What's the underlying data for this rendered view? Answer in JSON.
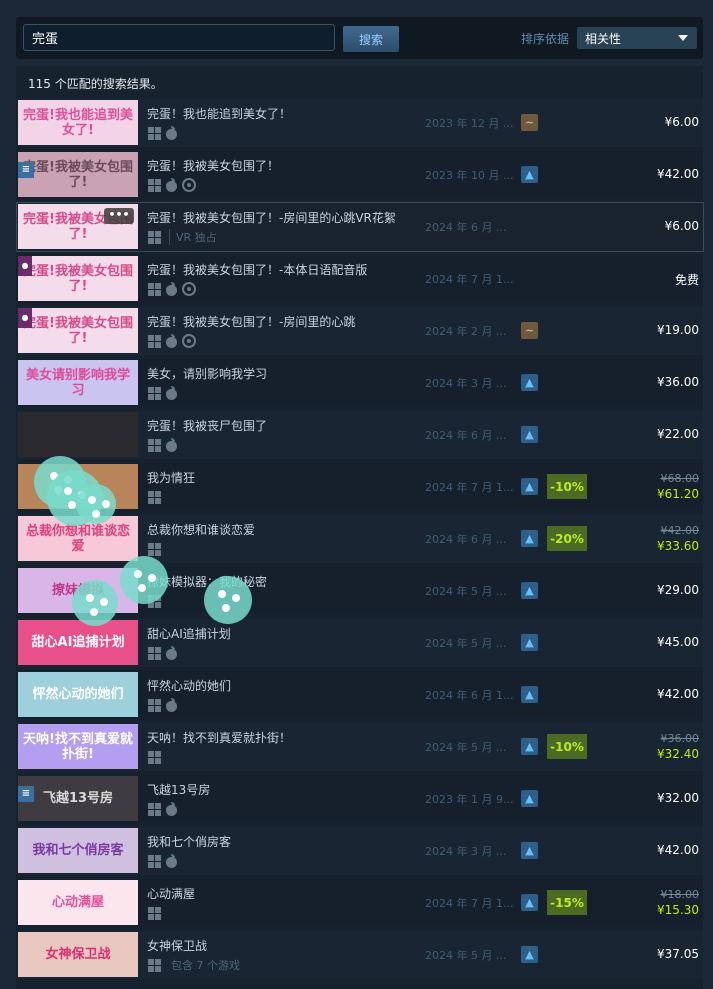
{
  "search": {
    "query": "完蛋",
    "button_label": "搜索"
  },
  "sort": {
    "label": "排序依据",
    "selected": "相关性"
  },
  "results_count": "115 个匹配的搜索结果。",
  "results": [
    {
      "capsule_text": "完蛋!我也能追到美女了!",
      "capsule_bg": "#f2d3e8",
      "capsule_fg": "#e0509a",
      "badge": "",
      "title": "完蛋！我也能追到美女了！",
      "platforms": [
        "win",
        "mac"
      ],
      "extra": "",
      "date": "2023 年 12 月 ...",
      "review": "mixed",
      "review_glyph": "~",
      "discount": "",
      "original_price": "",
      "price": "¥6.00"
    },
    {
      "capsule_text": "完蛋!我被美女包围了!",
      "capsule_bg": "#c9a3b4",
      "capsule_fg": "#6a4a5a",
      "badge": "menu",
      "title": "完蛋！我被美女包围了！",
      "platforms": [
        "win",
        "mac",
        "steam"
      ],
      "extra": "",
      "date": "2023 年 10 月 ...",
      "review": "positive",
      "review_glyph": "▲",
      "discount": "",
      "original_price": "",
      "price": "¥42.00"
    },
    {
      "capsule_text": "完蛋!我被美女包围了!",
      "capsule_bg": "#f4dcea",
      "capsule_fg": "#d94a8a",
      "badge": "more",
      "title": "完蛋！我被美女包围了！-房间里的心跳VR花絮",
      "platforms": [
        "win"
      ],
      "extra": "VR 独占",
      "date": "2024 年 6 月 ...",
      "review": "",
      "review_glyph": "",
      "discount": "",
      "original_price": "",
      "price": "¥6.00"
    },
    {
      "capsule_text": "完蛋!我被美女包围了!",
      "capsule_bg": "#f4dcea",
      "capsule_fg": "#d94a8a",
      "badge": "ribbon",
      "title": "完蛋！我被美女包围了！-本体日语配音版",
      "platforms": [
        "win",
        "mac",
        "steam"
      ],
      "extra": "",
      "date": "2024 年 7 月 1...",
      "review": "",
      "review_glyph": "",
      "discount": "",
      "original_price": "",
      "price": "免费"
    },
    {
      "capsule_text": "完蛋!我被美女包围了!",
      "capsule_bg": "#f4dcea",
      "capsule_fg": "#d94a8a",
      "badge": "ribbon",
      "title": "完蛋！我被美女包围了！-房间里的心跳",
      "platforms": [
        "win",
        "mac",
        "steam"
      ],
      "extra": "",
      "date": "2024 年 2 月 ...",
      "review": "mixed",
      "review_glyph": "~",
      "discount": "",
      "original_price": "",
      "price": "¥19.00"
    },
    {
      "capsule_text": "美女请别影响我学习",
      "capsule_bg": "#c9c4f0",
      "capsule_fg": "#e24a9a",
      "badge": "",
      "title": "美女，请别影响我学习",
      "platforms": [
        "win",
        "mac"
      ],
      "extra": "",
      "date": "2024 年 3 月 ...",
      "review": "positive",
      "review_glyph": "▲",
      "discount": "",
      "original_price": "",
      "price": "¥36.00"
    },
    {
      "capsule_text": "",
      "capsule_bg": "#2a2a2e",
      "capsule_fg": "#aa2222",
      "badge": "",
      "title": "完蛋！我被丧尸包围了",
      "platforms": [
        "win",
        "mac"
      ],
      "extra": "",
      "date": "2024 年 6 月 ...",
      "review": "positive",
      "review_glyph": "▲",
      "discount": "",
      "original_price": "",
      "price": "¥22.00"
    },
    {
      "capsule_text": "",
      "capsule_bg": "#b8855a",
      "capsule_fg": "#ffffff",
      "badge": "",
      "title": "我为情狂",
      "platforms": [
        "win"
      ],
      "extra": "",
      "date": "2024 年 7 月 1...",
      "review": "positive",
      "review_glyph": "▲",
      "discount": "-10%",
      "original_price": "¥68.00",
      "price": "¥61.20"
    },
    {
      "capsule_text": "总裁你想和谁谈恋爱",
      "capsule_bg": "#f6c8d8",
      "capsule_fg": "#e0407a",
      "badge": "",
      "title": "总裁你想和谁谈恋爱",
      "platforms": [
        "win"
      ],
      "extra": "",
      "date": "2024 年 6 月 ...",
      "review": "positive",
      "review_glyph": "▲",
      "discount": "-20%",
      "original_price": "¥42.00",
      "price": "¥33.60"
    },
    {
      "capsule_text": "撩妹模拟",
      "capsule_bg": "#d8b6e8",
      "capsule_fg": "#c03a8a",
      "badge": "",
      "title": "撩妹模拟器：我的秘密",
      "platforms": [
        "win"
      ],
      "extra": "",
      "date": "2024 年 5 月 ...",
      "review": "positive",
      "review_glyph": "▲",
      "discount": "",
      "original_price": "",
      "price": "¥29.00"
    },
    {
      "capsule_text": "甜心AI追捕计划",
      "capsule_bg": "#e8508a",
      "capsule_fg": "#ffffff",
      "badge": "",
      "title": "甜心AI追捕计划",
      "platforms": [
        "win",
        "mac"
      ],
      "extra": "",
      "date": "2024 年 5 月 ...",
      "review": "positive",
      "review_glyph": "▲",
      "discount": "",
      "original_price": "",
      "price": "¥45.00"
    },
    {
      "capsule_text": "怦然心动的她们",
      "capsule_bg": "#9ed0dc",
      "capsule_fg": "#ffffff",
      "badge": "",
      "title": "怦然心动的她们",
      "platforms": [
        "win",
        "mac"
      ],
      "extra": "",
      "date": "2024 年 6 月 1...",
      "review": "positive",
      "review_glyph": "▲",
      "discount": "",
      "original_price": "",
      "price": "¥42.00"
    },
    {
      "capsule_text": "天呐!找不到真爱就扑街!",
      "capsule_bg": "#b49ef0",
      "capsule_fg": "#ffffff",
      "badge": "",
      "title": "天呐！找不到真爱就扑街！",
      "platforms": [
        "win"
      ],
      "extra": "",
      "date": "2024 年 5 月 ...",
      "review": "positive",
      "review_glyph": "▲",
      "discount": "-10%",
      "original_price": "¥36.00",
      "price": "¥32.40"
    },
    {
      "capsule_text": "飞越13号房",
      "capsule_bg": "#3e3c40",
      "capsule_fg": "#d8d8d8",
      "badge": "menu",
      "title": "飞越13号房",
      "platforms": [
        "win",
        "mac"
      ],
      "extra": "",
      "date": "2023 年 1 月 9...",
      "review": "positive",
      "review_glyph": "▲",
      "discount": "",
      "original_price": "",
      "price": "¥32.00"
    },
    {
      "capsule_text": "我和七个俏房客",
      "capsule_bg": "#cfc0e0",
      "capsule_fg": "#7a3aa0",
      "badge": "",
      "title": "我和七个俏房客",
      "platforms": [
        "win",
        "mac"
      ],
      "extra": "",
      "date": "2024 年 3 月 ...",
      "review": "positive",
      "review_glyph": "▲",
      "discount": "",
      "original_price": "",
      "price": "¥42.00"
    },
    {
      "capsule_text": "心动满屋",
      "capsule_bg": "#fbe6ee",
      "capsule_fg": "#e8509a",
      "badge": "",
      "title": "心动满屋",
      "platforms": [
        "win"
      ],
      "extra": "",
      "date": "2024 年 7 月 1...",
      "review": "positive",
      "review_glyph": "▲",
      "discount": "-15%",
      "original_price": "¥18.00",
      "price": "¥15.30"
    },
    {
      "capsule_text": "女神保卫战",
      "capsule_bg": "#e8c8c0",
      "capsule_fg": "#e03070",
      "badge": "",
      "title": "女神保卫战",
      "platforms": [
        "win"
      ],
      "extra": "包含 7 个游戏",
      "date": "2024 年 5 月 ...",
      "review": "positive",
      "review_glyph": "▲",
      "discount": "",
      "original_price": "",
      "price": "¥37.05"
    }
  ]
}
